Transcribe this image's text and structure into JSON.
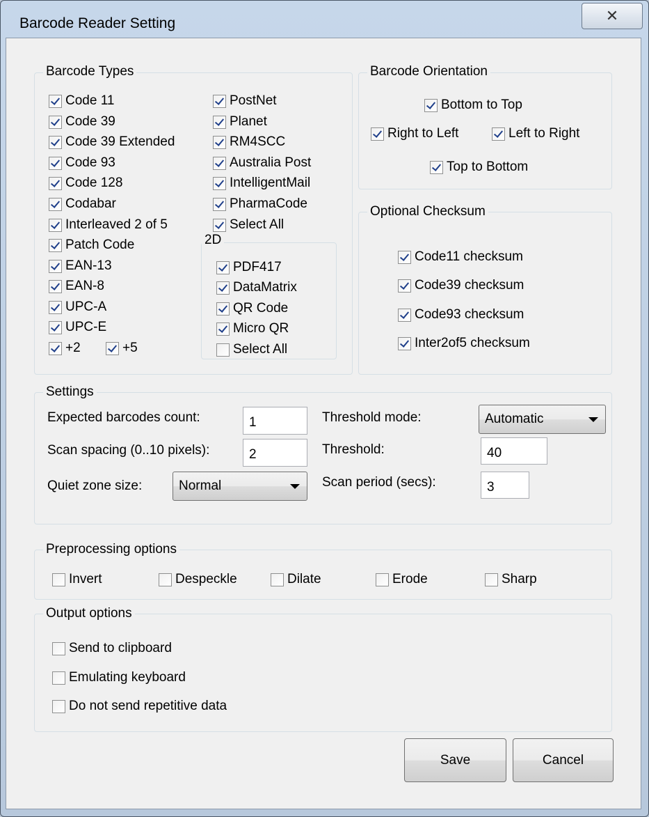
{
  "window": {
    "title": "Barcode Reader Setting",
    "close_glyph": "✕"
  },
  "barcode_types": {
    "label": "Barcode Types",
    "col1": [
      {
        "label": "Code 11",
        "checked": true
      },
      {
        "label": "Code 39",
        "checked": true
      },
      {
        "label": "Code 39 Extended",
        "checked": true
      },
      {
        "label": "Code 93",
        "checked": true
      },
      {
        "label": "Code 128",
        "checked": true
      },
      {
        "label": "Codabar",
        "checked": true
      },
      {
        "label": "Interleaved 2 of 5",
        "checked": true
      },
      {
        "label": "Patch Code",
        "checked": true
      },
      {
        "label": "EAN-13",
        "checked": true
      },
      {
        "label": "EAN-8",
        "checked": true
      },
      {
        "label": "UPC-A",
        "checked": true
      },
      {
        "label": "UPC-E",
        "checked": true
      }
    ],
    "plus2": {
      "label": "+2",
      "checked": true
    },
    "plus5": {
      "label": "+5",
      "checked": true
    },
    "col2": [
      {
        "label": "PostNet",
        "checked": true
      },
      {
        "label": "Planet",
        "checked": true
      },
      {
        "label": "RM4SCC",
        "checked": true
      },
      {
        "label": "Australia Post",
        "checked": true
      },
      {
        "label": "IntelligentMail",
        "checked": true
      },
      {
        "label": "PharmaCode",
        "checked": true
      },
      {
        "label": "Select All",
        "checked": true
      }
    ],
    "two_d": {
      "label": "2D",
      "items": [
        {
          "label": "PDF417",
          "checked": true
        },
        {
          "label": "DataMatrix",
          "checked": true
        },
        {
          "label": "QR Code",
          "checked": true
        },
        {
          "label": "Micro QR",
          "checked": true
        },
        {
          "label": "Select All",
          "checked": false
        }
      ]
    }
  },
  "orientation": {
    "label": "Barcode Orientation",
    "bottom_to_top": {
      "label": "Bottom to Top",
      "checked": true
    },
    "right_to_left": {
      "label": "Right to Left",
      "checked": true
    },
    "left_to_right": {
      "label": "Left to Right",
      "checked": true
    },
    "top_to_bottom": {
      "label": "Top to Bottom",
      "checked": true
    }
  },
  "checksum": {
    "label": "Optional Checksum",
    "items": [
      {
        "label": "Code11 checksum",
        "checked": true
      },
      {
        "label": "Code39 checksum",
        "checked": true
      },
      {
        "label": "Code93 checksum",
        "checked": true
      },
      {
        "label": "Inter2of5 checksum",
        "checked": true
      }
    ]
  },
  "settings": {
    "label": "Settings",
    "expected_count_label": "Expected barcodes count:",
    "expected_count_value": "1",
    "scan_spacing_label": "Scan spacing (0..10 pixels):",
    "scan_spacing_value": "2",
    "quiet_zone_label": "Quiet zone size:",
    "quiet_zone_value": "Normal",
    "threshold_mode_label": "Threshold mode:",
    "threshold_mode_value": "Automatic",
    "threshold_label": "Threshold:",
    "threshold_value": "40",
    "scan_period_label": "Scan period (secs):",
    "scan_period_value": "3"
  },
  "preprocessing": {
    "label": "Preprocessing options",
    "items": [
      {
        "label": "Invert",
        "checked": false
      },
      {
        "label": "Despeckle",
        "checked": false
      },
      {
        "label": "Dilate",
        "checked": false
      },
      {
        "label": "Erode",
        "checked": false
      },
      {
        "label": "Sharp",
        "checked": false
      }
    ]
  },
  "output": {
    "label": "Output options",
    "items": [
      {
        "label": "Send to clipboard",
        "checked": false
      },
      {
        "label": "Emulating keyboard",
        "checked": false
      },
      {
        "label": "Do not send repetitive data",
        "checked": false
      }
    ]
  },
  "buttons": {
    "save": "Save",
    "cancel": "Cancel"
  }
}
